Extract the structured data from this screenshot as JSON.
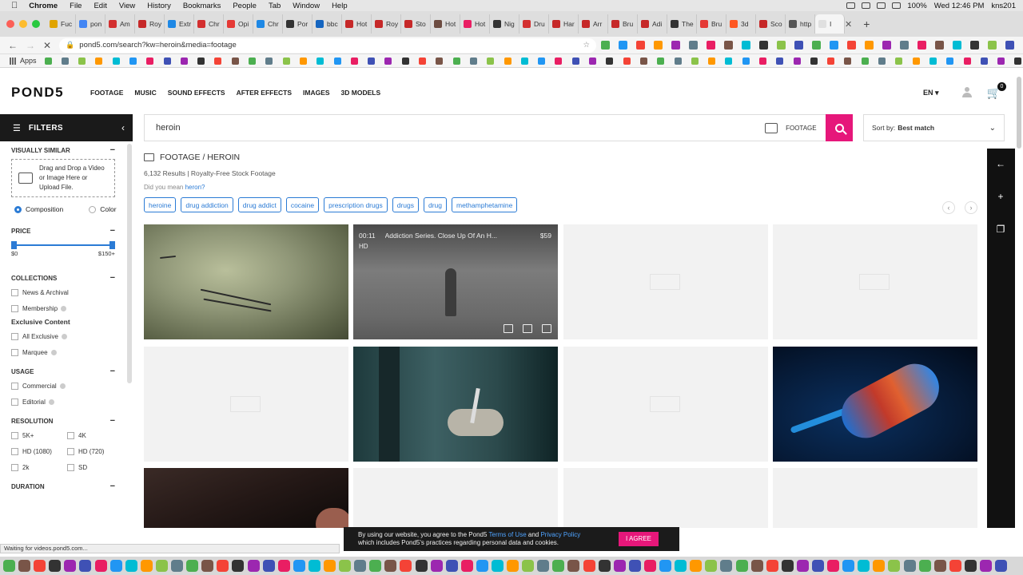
{
  "menubar": {
    "app": "Chrome",
    "menus": [
      "File",
      "Edit",
      "View",
      "History",
      "Bookmarks",
      "People",
      "Tab",
      "Window",
      "Help"
    ],
    "battery": "100%",
    "clock": "Wed 12:46 PM",
    "user": "kns201"
  },
  "tabs": [
    {
      "label": "Fuc",
      "color": "#e0a400"
    },
    {
      "label": "pon",
      "color": "#4285f4"
    },
    {
      "label": "Am",
      "color": "#d32f2f"
    },
    {
      "label": "Roy",
      "color": "#c62828"
    },
    {
      "label": "Extr",
      "color": "#1e88e5"
    },
    {
      "label": "Chr",
      "color": "#d32f2f"
    },
    {
      "label": "Opi",
      "color": "#e53935"
    },
    {
      "label": "Chr",
      "color": "#1e88e5"
    },
    {
      "label": "Por",
      "color": "#333333"
    },
    {
      "label": "bbc",
      "color": "#1565c0"
    },
    {
      "label": "Hot",
      "color": "#c62828"
    },
    {
      "label": "Roy",
      "color": "#c62828"
    },
    {
      "label": "Sto",
      "color": "#c62828"
    },
    {
      "label": "Hot",
      "color": "#6d4c41"
    },
    {
      "label": "Hot",
      "color": "#e91e63"
    },
    {
      "label": "Nig",
      "color": "#333333"
    },
    {
      "label": "Dru",
      "color": "#d32f2f"
    },
    {
      "label": "Har",
      "color": "#c62828"
    },
    {
      "label": "Arr",
      "color": "#c62828"
    },
    {
      "label": "Bru",
      "color": "#c62828"
    },
    {
      "label": "Adi",
      "color": "#c62828"
    },
    {
      "label": "The",
      "color": "#333333"
    },
    {
      "label": "Bru",
      "color": "#e53935"
    },
    {
      "label": "3d",
      "color": "#ff5722"
    },
    {
      "label": "Sco",
      "color": "#c62828"
    },
    {
      "label": "http",
      "color": "#555555"
    },
    {
      "label": "I",
      "color": "#e0e0e0"
    }
  ],
  "address": {
    "url": "pond5.com/search?kw=heroin&media=footage"
  },
  "bookmarks": {
    "apps_label": "Apps"
  },
  "header": {
    "logo": "POND5",
    "nav": [
      "FOOTAGE",
      "MUSIC",
      "SOUND EFFECTS",
      "AFTER EFFECTS",
      "IMAGES",
      "3D MODELS"
    ],
    "lang": "EN",
    "cart_count": "0"
  },
  "filters": {
    "title": "FILTERS",
    "visually_similar": {
      "title": "VISUALLY SIMILAR",
      "drop_text_1": "Drag and Drop a Video",
      "drop_text_2": "or Image Here or",
      "drop_text_3": "Upload File.",
      "opt_composition": "Composition",
      "opt_color": "Color",
      "selected": "Composition"
    },
    "price": {
      "title": "PRICE",
      "min": "$0",
      "max": "$150+"
    },
    "collections": {
      "title": "COLLECTIONS",
      "items": [
        "News & Archival",
        "Membership"
      ],
      "exclusive_title": "Exclusive Content",
      "exclusive_items": [
        "All Exclusive",
        "Marquee"
      ]
    },
    "usage": {
      "title": "USAGE",
      "items": [
        "Commercial",
        "Editorial"
      ]
    },
    "resolution": {
      "title": "RESOLUTION",
      "items": [
        "5K+",
        "4K",
        "HD (1080)",
        "HD (720)",
        "2k",
        "SD"
      ]
    },
    "duration": {
      "title": "DURATION"
    }
  },
  "search": {
    "query": "heroin",
    "media_type": "FOOTAGE",
    "sort_prefix": "Sort by:",
    "sort_value": "Best match"
  },
  "results": {
    "breadcrumb": "FOOTAGE / HEROIN",
    "count": "6,132 Results | Royalty-Free Stock Footage",
    "did_you_mean": "Did you mean",
    "suggestion": "heron?",
    "tags": [
      "heroine",
      "drug addiction",
      "drug addict",
      "cocaine",
      "prescription drugs",
      "drugs",
      "drug",
      "methamphetamine"
    ],
    "hover_item": {
      "duration": "00:11",
      "title": "Addiction Series. Close Up Of An H...",
      "price": "$59",
      "quality": "HD"
    }
  },
  "cookie": {
    "text_1": "By using our website, you agree to the Pond5",
    "terms": "Terms of Use",
    "and": "and",
    "privacy": "Privacy Policy",
    "text_2": "which includes Pond5's practices regarding personal data and cookies.",
    "button": "I AGREE"
  },
  "status_bar": "Waiting for videos.pond5.com...",
  "colors": {
    "accent": "#e6177a",
    "link": "#2b7bd5",
    "dark": "#1a1a1a"
  }
}
